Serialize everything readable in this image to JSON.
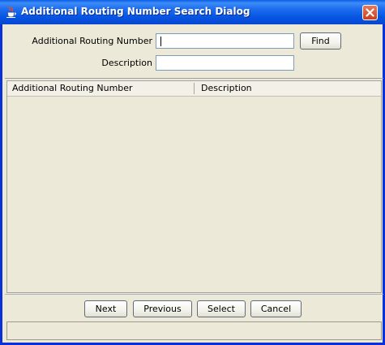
{
  "window": {
    "title": "Additional Routing Number Search Dialog",
    "title_icon": "java-coffee-cup-icon",
    "close_icon": "close-icon"
  },
  "search": {
    "routing_label": "Additional Routing Number",
    "routing_value": "",
    "description_label": "Description",
    "description_value": "",
    "find_label": "Find"
  },
  "table": {
    "columns": [
      "Additional Routing Number",
      "Description"
    ],
    "rows": []
  },
  "nav": {
    "next_label": "Next",
    "previous_label": "Previous",
    "select_label": "Select",
    "cancel_label": "Cancel"
  },
  "status": {
    "text": ""
  }
}
